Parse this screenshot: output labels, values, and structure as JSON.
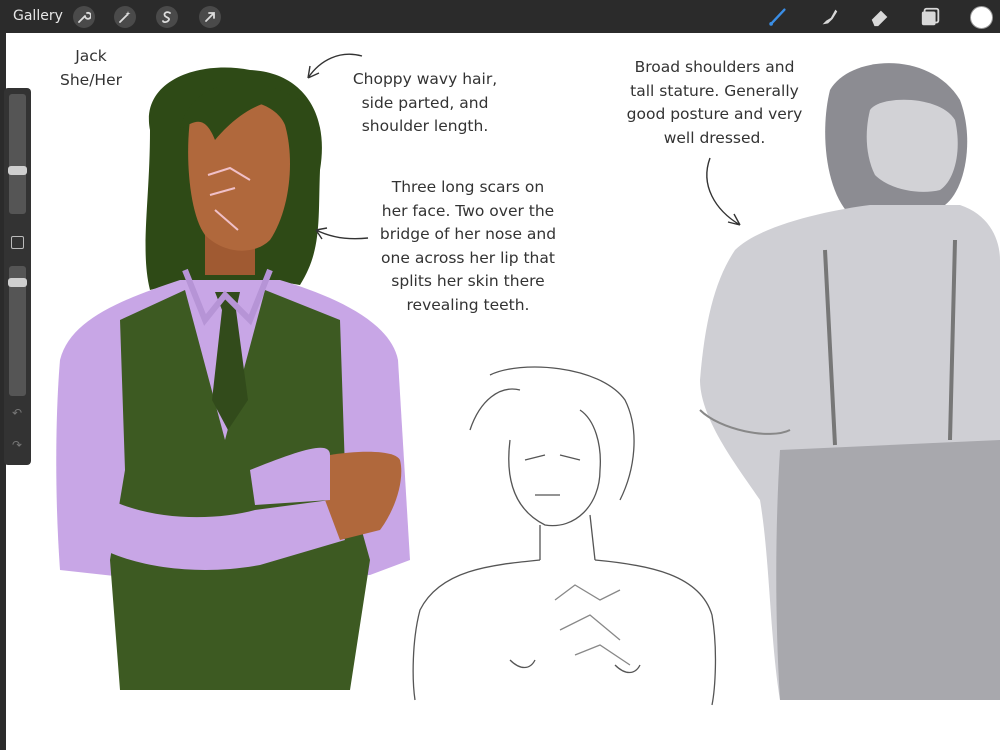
{
  "toolbar": {
    "gallery_label": "Gallery",
    "action_icons": [
      "wrench-icon",
      "magic-wand-icon",
      "selection-s-icon",
      "transform-arrow-icon"
    ],
    "tool_icons": [
      "brush-icon",
      "smudge-icon",
      "eraser-icon",
      "layers-icon"
    ],
    "active_tool_color": "#3a8ee6",
    "current_color": "#ffffff"
  },
  "sidebar": {
    "size_slider_level": 0.55,
    "opacity_slider_level": 0.9,
    "icons": [
      "modify-square-icon",
      "undo-icon",
      "redo-icon"
    ]
  },
  "canvas": {
    "character_name": "Jack",
    "pronouns": "She/Her",
    "note_hair": [
      "Choppy wavy hair,",
      "side parted, and",
      "shoulder length."
    ],
    "note_scars": [
      "Three long scars on",
      "her face. Two over the",
      "bridge of her nose and",
      "one across her lip that",
      "splits her skin there",
      "revealing teeth."
    ],
    "note_build": [
      "Broad shoulders and",
      "tall stature. Generally",
      "good posture and very",
      "well dressed."
    ],
    "colors": {
      "hair": "#2e4a16",
      "skin": "#b0683c",
      "shirt": "#c8a6e6",
      "vest": "#3d5a22",
      "sketch_gray": "#a8a8ad"
    }
  }
}
